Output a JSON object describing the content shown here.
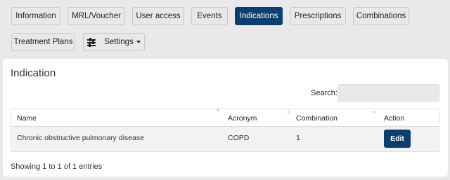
{
  "tabs": [
    {
      "label": "Information",
      "active": false
    },
    {
      "label": "MRL/Voucher",
      "active": false
    },
    {
      "label": "User access",
      "active": false
    },
    {
      "label": "Events",
      "active": false
    },
    {
      "label": "Indications",
      "active": true
    },
    {
      "label": "Prescriptions",
      "active": false
    },
    {
      "label": "Combinations",
      "active": false
    },
    {
      "label": "Treatment Plans",
      "active": false
    }
  ],
  "settings_label": "Settings",
  "card": {
    "title": "Indication",
    "search_label": "Search:",
    "search_value": "",
    "columns": [
      "Name",
      "Acronym",
      "Combination",
      "Action"
    ],
    "rows": [
      {
        "name": "Chronic obstructive pulmonary disease",
        "acronym": "COPD",
        "combination": "1",
        "action": "Edit"
      }
    ],
    "info": "Showing 1 to 1 of 1 entries"
  },
  "colors": {
    "accent": "#0d3f6e",
    "background": "#e9e9e9"
  },
  "icons": {
    "settings": "sliders-icon",
    "dropdown": "caret-down-icon"
  }
}
